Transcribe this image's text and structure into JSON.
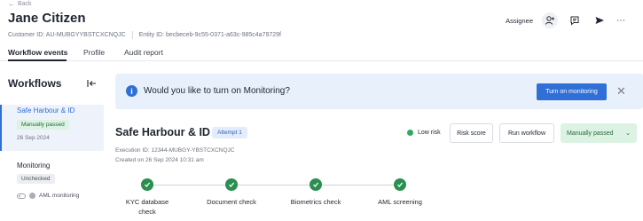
{
  "header": {
    "back_label": "Back",
    "title": "Jane Citizen",
    "customer_id": "Customer ID: AU-MUBGYYBSTCXCNQJC",
    "entity_id": "Entity ID: becbeceb-9c55-0371-a63c-985c4a79729f",
    "assignee_label": "Assignee"
  },
  "tabs": [
    {
      "label": "Workflow events",
      "active": true
    },
    {
      "label": "Profile",
      "active": false
    },
    {
      "label": "Audit report",
      "active": false
    }
  ],
  "sidebar": {
    "heading": "Workflows",
    "items": [
      {
        "title": "Safe Harbour & ID",
        "status": "Manually passed",
        "date": "26 Sep 2024",
        "active": true
      },
      {
        "title": "Monitoring",
        "status": "Unchecked",
        "sub": "AML monitoring",
        "active": false
      }
    ]
  },
  "banner": {
    "text": "Would you like to turn on Monitoring?",
    "button_label": "Turn on monitoring"
  },
  "workflow": {
    "title": "Safe Harbour & ID",
    "attempt": "Attempt 1",
    "execution_id": "Execution ID: 12344-MUBGY-YBSTCXCNQJC",
    "created": "Created on 26 Sep 2024 10:31 am",
    "risk_label": "Low risk",
    "risk_score_label": "Risk score",
    "run_workflow_label": "Run workflow",
    "status_label": "Manually passed"
  },
  "steps": [
    {
      "label": "KYC database check",
      "status": "passed"
    },
    {
      "label": "Document check",
      "status": "passed"
    },
    {
      "label": "Biometrics check",
      "status": "passed"
    },
    {
      "label": "AML screening",
      "status": "passed"
    }
  ],
  "colors": {
    "accent": "#2f6fd6",
    "success": "#2a8f4f",
    "success_bg": "#dcf2e3",
    "banner_bg": "#e8f1fb"
  }
}
